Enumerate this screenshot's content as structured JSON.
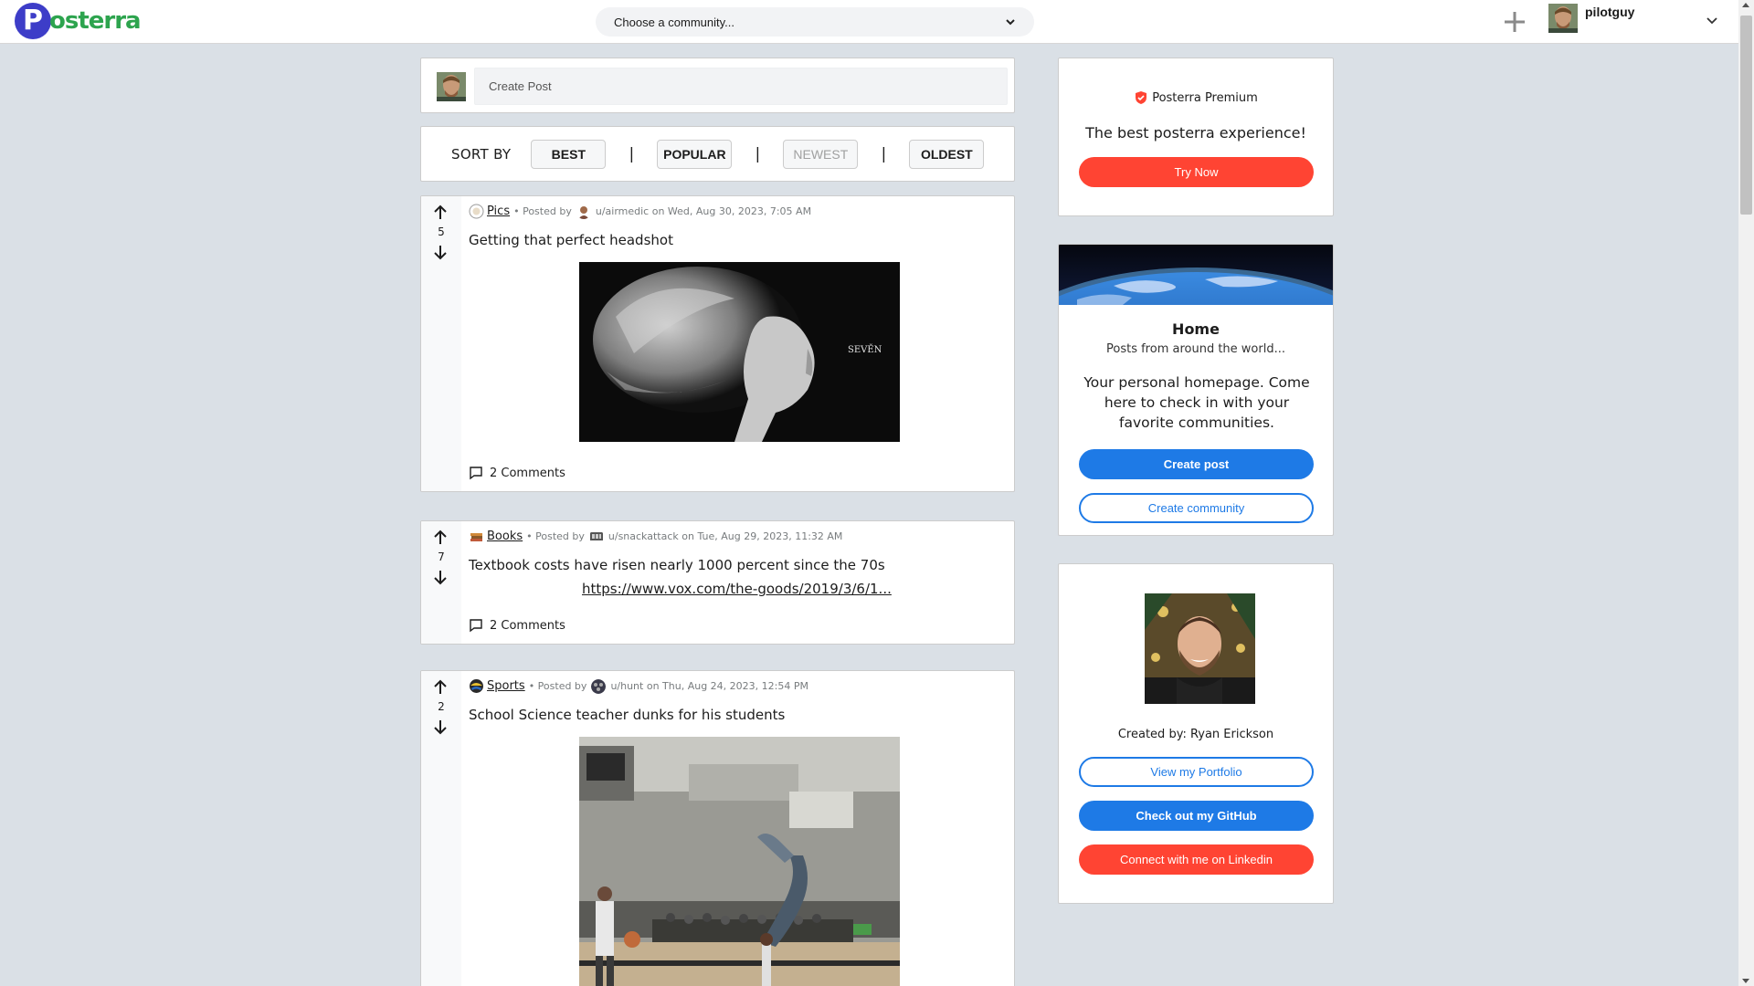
{
  "header": {
    "logo_initial": "P",
    "logo_rest": "osterra",
    "community_placeholder": "Choose a community...",
    "username": "pilotguy"
  },
  "create_post": {
    "placeholder": "Create Post"
  },
  "sort": {
    "label": "SORT BY",
    "options": [
      "BEST",
      "POPULAR",
      "NEWEST",
      "OLDEST"
    ],
    "separator": "|",
    "disabled": "NEWEST"
  },
  "posts": [
    {
      "votes": "5",
      "community": "Pics",
      "posted_by_prefix": "• Posted by",
      "author_line": "u/airmedic on Wed, Aug 30, 2023, 7:05 AM",
      "title": "Getting that perfect headshot",
      "image_caption": "SEVĚN",
      "comments": "2 Comments"
    },
    {
      "votes": "7",
      "community": "Books",
      "posted_by_prefix": "• Posted by",
      "author_line": "u/snackattack on Tue, Aug 29, 2023, 11:32 AM",
      "title": "Textbook costs have risen nearly 1000 percent since the 70s",
      "link": "https://www.vox.com/the-goods/2019/3/6/1...",
      "comments": "2 Comments"
    },
    {
      "votes": "2",
      "community": "Sports",
      "posted_by_prefix": "• Posted by",
      "author_line": "u/hunt on Thu, Aug 24, 2023, 12:54 PM",
      "title": "School Science teacher dunks for his students"
    }
  ],
  "premium": {
    "title": "Posterra Premium",
    "subtitle": "The best posterra experience!",
    "button": "Try Now"
  },
  "home": {
    "title": "Home",
    "subtitle": "Posts from around the world...",
    "description": "Your personal homepage. Come here to check in with your favorite communities.",
    "create_post": "Create post",
    "create_community": "Create community"
  },
  "creator": {
    "text": "Created by: Ryan Erickson",
    "portfolio": "View my Portfolio",
    "github": "Check out my GitHub",
    "linkedin": "Connect with me on Linkedin"
  },
  "colors": {
    "brand_blue": "#3d3dc8",
    "brand_green": "#2da44e",
    "accent_blue": "#1e7ae6",
    "accent_red": "#ff4433",
    "page_bg": "#dae0e6"
  }
}
